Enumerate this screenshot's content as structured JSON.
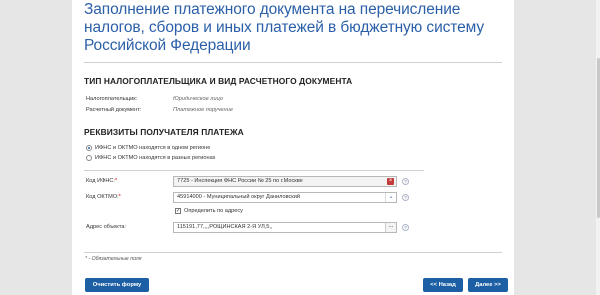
{
  "page": {
    "title": "Заполнение платежного документа на перечисление налогов, сборов и иных платежей в бюджетную систему Российской Федерации"
  },
  "section1": {
    "heading": "ТИП НАЛОГОПЛАТЕЛЬЩИКА И ВИД РАСЧЕТНОГО ДОКУМЕНТА",
    "taxpayer_label": "Налогоплательщик:",
    "taxpayer_value": "Юридическое лицо",
    "doc_label": "Расчетный документ:",
    "doc_value": "Платежное поручение"
  },
  "section2": {
    "heading": "РЕКВИЗИТЫ ПОЛУЧАТЕЛЯ ПЛАТЕЖА",
    "radio_same": "ИФНС и ОКТМО находятся в одном регионе",
    "radio_diff": "ИФНС и ОКТМО находятся в разных регионах",
    "ifns_label": "Код ИФНС:",
    "ifns_value": "7725 - Инспекция ФНС России № 25 по г.Москве",
    "oktmo_label": "Код ОКТМО:",
    "oktmo_value": "45914000 - Муниципальный округ Даниловский",
    "check_label": "Определить по адресу",
    "addr_label": "Адрес объекта:",
    "addr_value": "115191,77,,,,РОЩИНСКАЯ 2-Я УЛ,5,,",
    "required_mark": "*"
  },
  "icons": {
    "clear": "×",
    "dropdown": "⌄",
    "dots": "...",
    "help": "?",
    "check": "✓"
  },
  "footer": {
    "note": "* - Обязательные поля",
    "clear_label": "Очистить форму",
    "back_label": "<< Назад",
    "next_label": "Далее >>"
  },
  "colors": {
    "accent": "#2b5fa8",
    "button": "#1c5fa5",
    "required": "#d00000"
  }
}
